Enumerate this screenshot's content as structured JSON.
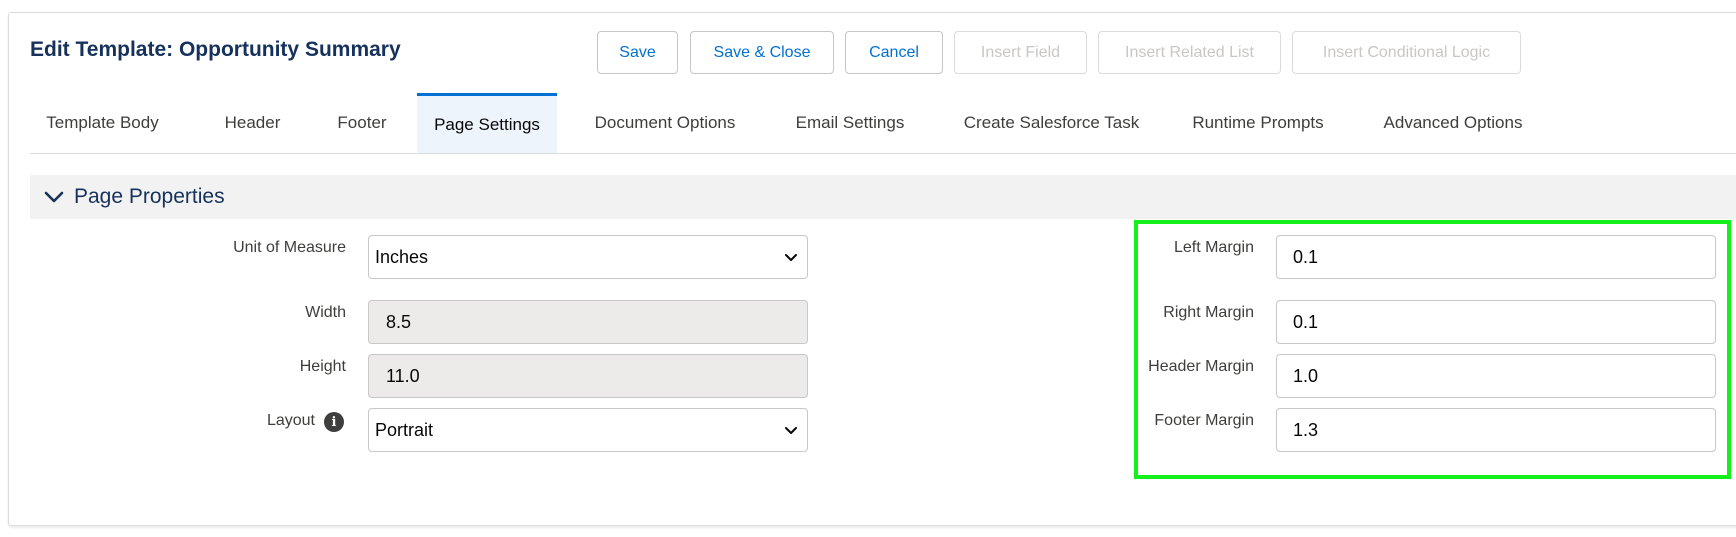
{
  "header": {
    "title": "Edit Template: Opportunity Summary",
    "buttons": {
      "save": "Save",
      "save_close": "Save & Close",
      "cancel": "Cancel",
      "insert_field": "Insert Field",
      "insert_related_list": "Insert Related List",
      "insert_conditional_logic": "Insert Conditional Logic"
    }
  },
  "tabs": [
    {
      "label": "Template Body"
    },
    {
      "label": "Header"
    },
    {
      "label": "Footer"
    },
    {
      "label": "Page Settings",
      "active": true
    },
    {
      "label": "Document Options"
    },
    {
      "label": "Email Settings"
    },
    {
      "label": "Create Salesforce Task"
    },
    {
      "label": "Runtime Prompts"
    },
    {
      "label": "Advanced Options"
    }
  ],
  "section": {
    "title": "Page Properties",
    "icon": "chevron-down-icon"
  },
  "left_fields": {
    "unit_label": "Unit of Measure",
    "unit_value": "Inches",
    "width_label": "Width",
    "width_value": "8.5",
    "height_label": "Height",
    "height_value": "11.0",
    "layout_label": "Layout",
    "layout_value": "Portrait",
    "info_icon": "info-icon"
  },
  "right_fields": {
    "left_margin_label": "Left Margin",
    "left_margin_value": "0.1",
    "right_margin_label": "Right Margin",
    "right_margin_value": "0.1",
    "header_margin_label": "Header Margin",
    "header_margin_value": "1.0",
    "footer_margin_label": "Footer Margin",
    "footer_margin_value": "1.3"
  },
  "colors": {
    "brand_blue": "#0070d2",
    "title_navy": "#16325c",
    "highlight_green": "#14f01b"
  }
}
